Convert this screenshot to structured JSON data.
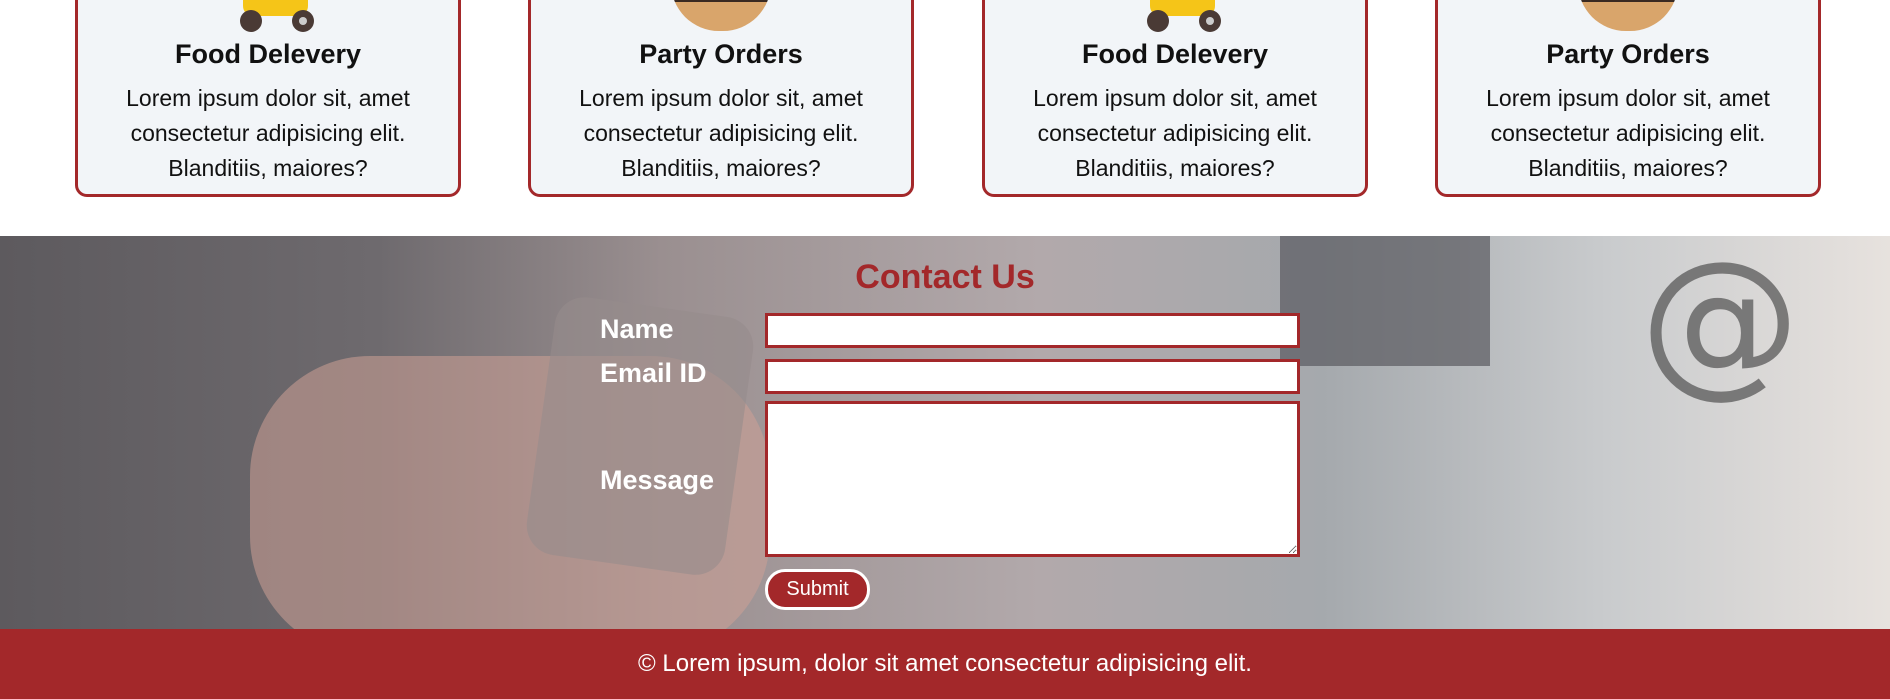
{
  "services": [
    {
      "title": "Food Delevery",
      "text": "Lorem ipsum dolor sit, amet consectetur adipisicing elit. Blanditiis, maiores?",
      "image": "scooter"
    },
    {
      "title": "Party Orders",
      "text": "Lorem ipsum dolor sit, amet consectetur adipisicing elit. Blanditiis, maiores?",
      "image": "burger"
    },
    {
      "title": "Food Delevery",
      "text": "Lorem ipsum dolor sit, amet consectetur adipisicing elit. Blanditiis, maiores?",
      "image": "scooter"
    },
    {
      "title": "Party Orders",
      "text": "Lorem ipsum dolor sit, amet consectetur adipisicing elit. Blanditiis, maiores?",
      "image": "burger"
    }
  ],
  "contact": {
    "title": "Contact Us",
    "name_label": "Name",
    "name_value": "",
    "email_label": "Email ID",
    "email_value": "",
    "message_label": "Message",
    "message_value": "",
    "submit_label": "Submit"
  },
  "footer": {
    "text": "© Lorem ipsum, dolor sit amet consectetur adipisicing elit."
  },
  "colors": {
    "accent": "#a3282a",
    "card_bg": "#f2f5f8"
  }
}
